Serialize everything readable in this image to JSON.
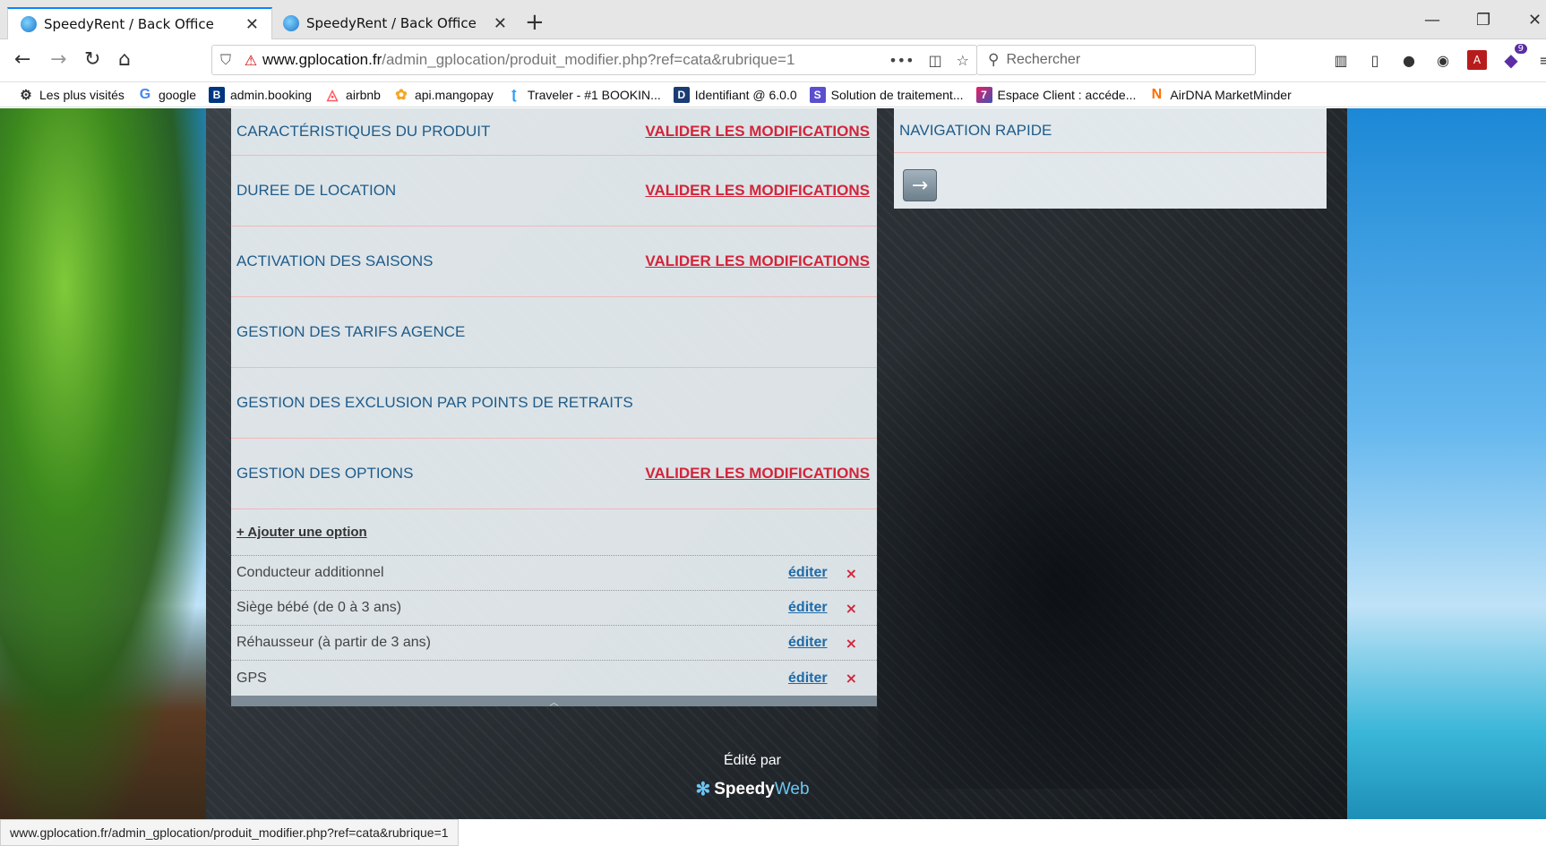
{
  "tabs": [
    {
      "label": "SpeedyRent / Back Office",
      "active": true
    },
    {
      "label": "SpeedyRent / Back Office",
      "active": false
    }
  ],
  "nav": {
    "url_domain": "www.gplocation.fr",
    "url_path": "/admin_gplocation/produit_modifier.php?ref=cata&rubrique=1",
    "search_placeholder": "Rechercher",
    "extension_badge": "9"
  },
  "bookmarks": [
    {
      "label": "Les plus visités",
      "icon": "gear-icon"
    },
    {
      "label": "google",
      "icon": "google-icon"
    },
    {
      "label": "admin.booking",
      "icon": "booking-icon"
    },
    {
      "label": "airbnb",
      "icon": "airbnb-icon"
    },
    {
      "label": "api.mangopay",
      "icon": "mangopay-icon"
    },
    {
      "label": "Traveler - #1 BOOKIN...",
      "icon": "traveler-icon"
    },
    {
      "label": "Identifiant @ 6.0.0",
      "icon": "identifiant-icon"
    },
    {
      "label": "Solution de traitement...",
      "icon": "solution-icon"
    },
    {
      "label": "Espace Client : accéde...",
      "icon": "espace-client-icon"
    },
    {
      "label": "AirDNA MarketMinder",
      "icon": "airdna-icon"
    }
  ],
  "sections": [
    {
      "title": "CARACTÉRISTIQUES DU PRODUIT",
      "action": "VALIDER LES MODIFICATIONS"
    },
    {
      "title": "DUREE DE LOCATION",
      "action": "VALIDER LES MODIFICATIONS"
    },
    {
      "title": "ACTIVATION DES SAISONS",
      "action": "VALIDER LES MODIFICATIONS"
    },
    {
      "title": "GESTION DES TARIFS AGENCE",
      "action": ""
    },
    {
      "title": "GESTION DES EXCLUSION PAR POINTS DE RETRAITS",
      "action": ""
    },
    {
      "title": "GESTION DES OPTIONS",
      "action": "VALIDER LES MODIFICATIONS"
    }
  ],
  "options": {
    "add_label": "+ Ajouter une option",
    "edit_label": "éditer",
    "delete_label": "×",
    "items": [
      "Conducteur additionnel",
      "Siège bébé (de 0 à 3 ans)",
      "Réhausseur (à partir de 3 ans)",
      "GPS"
    ]
  },
  "sidebar": {
    "title": "NAVIGATION RAPIDE"
  },
  "footer": {
    "edited_by": "Édité par",
    "brand_part1": "Speedy",
    "brand_part2": "Web"
  },
  "status_url": "www.gplocation.fr/admin_gplocation/produit_modifier.php?ref=cata&rubrique=1"
}
